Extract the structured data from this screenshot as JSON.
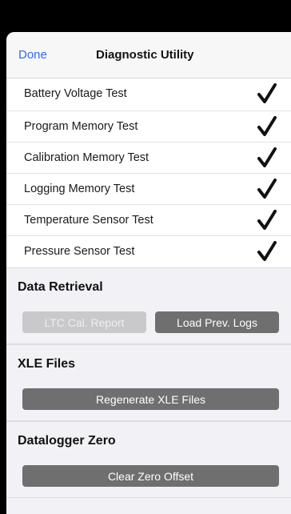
{
  "nav": {
    "done_label": "Done",
    "title": "Diagnostic Utility"
  },
  "tests": [
    {
      "label": "Battery Voltage Test",
      "passed": true
    },
    {
      "label": "Program Memory Test",
      "passed": true
    },
    {
      "label": "Calibration Memory Test",
      "passed": true
    },
    {
      "label": "Logging Memory Test",
      "passed": true
    },
    {
      "label": "Temperature Sensor Test",
      "passed": true
    },
    {
      "label": "Pressure Sensor Test",
      "passed": true
    }
  ],
  "data_retrieval": {
    "title": "Data Retrieval",
    "ltc_button": "LTC Cal. Report",
    "load_button": "Load Prev. Logs"
  },
  "xle_files": {
    "title": "XLE Files",
    "regenerate_button": "Regenerate XLE Files"
  },
  "datalogger_zero": {
    "title": "Datalogger Zero",
    "clear_button": "Clear Zero Offset"
  },
  "colors": {
    "accent": "#2f6bf0",
    "button_active": "#6f6f70",
    "button_disabled": "#c9c9cb",
    "background": "#f2f2f6"
  },
  "icons": {
    "check": "checkmark-icon"
  }
}
